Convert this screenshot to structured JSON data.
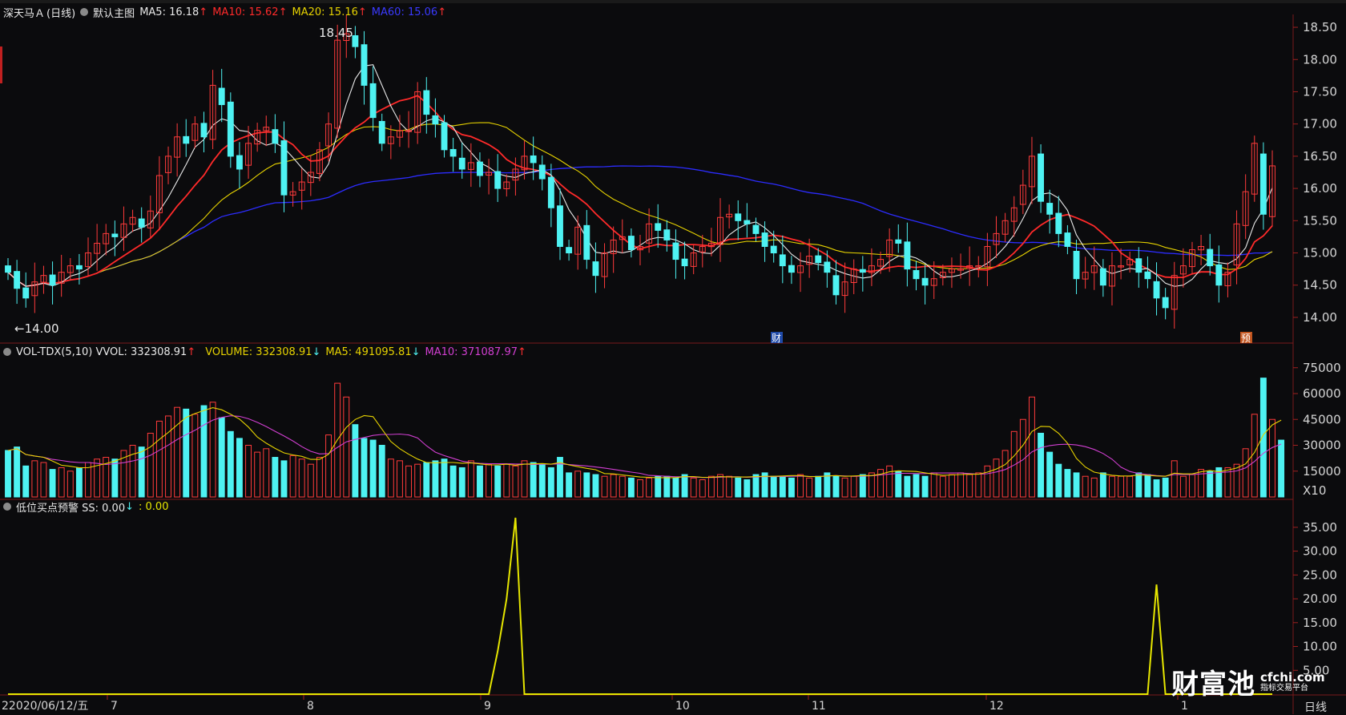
{
  "main_panel": {
    "stock_name": "深天马Ａ",
    "period": "(日线)",
    "template": "默认主图",
    "indicators": [
      {
        "label": "MA5: 16.18",
        "arrow": "↑",
        "color": "#e8e8e8"
      },
      {
        "label": "MA10: 15.62",
        "arrow": "↑",
        "color": "#ff2a2a"
      },
      {
        "label": "MA20: 15.16",
        "arrow": "↑",
        "color": "#e6d200"
      },
      {
        "label": "MA60: 15.06",
        "arrow": "↑",
        "color": "#2c2cff"
      }
    ],
    "high_marker": "18.45",
    "low_marker": "←14.00",
    "event_tags": [
      "财",
      "预"
    ]
  },
  "volume_panel": {
    "indicator": "VOL-TDX(5,10) VVOL: 332308.91",
    "indicator_arrow": "↑",
    "items": [
      {
        "label": "VOLUME: 332308.91",
        "arrow": "↓",
        "color": "#e6d200"
      },
      {
        "label": "MA5: 491095.81",
        "arrow": "↓",
        "color": "#e6d200"
      },
      {
        "label": "MA10: 371087.97",
        "arrow": "↑",
        "color": "#d13fd1"
      }
    ],
    "unit": "X10"
  },
  "signal_panel": {
    "indicator": "低位买点预警 SS: 0.00",
    "arrow": "↓",
    "extra": ": 0.00"
  },
  "date_axis": {
    "first_label": "2020/06/12/五",
    "months": [
      "7",
      "8",
      "9",
      "10",
      "11",
      "12",
      "1"
    ]
  },
  "period_button": "日线",
  "watermark": {
    "brand": "财富池",
    "site": "cfchi.com",
    "tagline": "指标交易平台"
  },
  "colors": {
    "up": "#ff3b3b",
    "down": "#4ef2f2",
    "ma5": "#e8e8e8",
    "ma10": "#ff2a2a",
    "ma20": "#e6d200",
    "ma60": "#2c2cff",
    "ss": "#e6e600"
  },
  "chart_data": [
    {
      "type": "candlestick",
      "title": "深天马Ａ (日线)",
      "y_ticks": [
        14.0,
        14.5,
        15.0,
        15.5,
        16.0,
        16.5,
        17.0,
        17.5,
        18.0,
        18.5
      ],
      "ylim": [
        13.85,
        18.6
      ],
      "x_labels": [
        "2020/06/12/五",
        "7",
        "8",
        "9",
        "10",
        "11",
        "12",
        "1"
      ],
      "series": [
        {
          "name": "MA5",
          "last": 16.18
        },
        {
          "name": "MA10",
          "last": 15.62
        },
        {
          "name": "MA20",
          "last": 15.16
        },
        {
          "name": "MA60",
          "last": 15.06
        }
      ],
      "annotations": [
        "18.45",
        "←14.00"
      ],
      "closes": [
        14.7,
        14.45,
        14.3,
        14.55,
        14.65,
        14.5,
        14.7,
        14.8,
        14.75,
        15.0,
        15.15,
        15.3,
        15.25,
        15.45,
        15.55,
        15.4,
        15.65,
        16.2,
        16.5,
        16.8,
        16.7,
        17.0,
        16.8,
        17.6,
        17.3,
        16.5,
        16.3,
        16.7,
        16.9,
        16.95,
        16.7,
        15.9,
        15.95,
        16.1,
        16.25,
        16.6,
        17.0,
        18.3,
        18.4,
        18.2,
        17.6,
        17.1,
        16.7,
        16.8,
        16.9,
        16.9,
        17.5,
        17.15,
        17.0,
        16.6,
        16.5,
        16.3,
        16.4,
        16.2,
        16.25,
        16.0,
        16.1,
        16.3,
        16.5,
        16.4,
        16.15,
        15.7,
        15.1,
        15.0,
        15.4,
        14.9,
        14.65,
        15.0,
        15.2,
        15.25,
        15.05,
        15.1,
        15.45,
        15.35,
        15.2,
        14.9,
        14.8,
        15.0,
        15.1,
        15.15,
        15.55,
        15.6,
        15.5,
        15.45,
        15.3,
        15.1,
        15.0,
        14.8,
        14.7,
        14.8,
        14.95,
        14.85,
        14.7,
        14.35,
        14.55,
        14.75,
        14.7,
        14.8,
        14.9,
        15.2,
        15.15,
        14.75,
        14.6,
        14.5,
        14.6,
        14.7,
        14.75,
        14.75,
        14.8,
        14.8,
        15.1,
        15.3,
        15.5,
        15.7,
        16.05,
        16.5,
        15.8,
        15.6,
        15.3,
        15.1,
        14.6,
        14.7,
        14.8,
        14.5,
        14.8,
        14.8,
        14.9,
        14.7,
        14.6,
        14.3,
        14.15,
        14.65,
        14.8,
        15.05,
        15.1,
        14.8,
        14.5,
        14.7,
        15.45,
        15.95,
        16.7,
        15.6,
        16.35
      ]
    },
    {
      "type": "bar",
      "title": "VOL-TDX(5,10)",
      "unit": "X10",
      "y_ticks": [
        15000,
        30000,
        45000,
        60000,
        75000
      ],
      "ylim": [
        0,
        80000
      ],
      "series": [
        {
          "name": "VOLUME",
          "last": 332308.91
        },
        {
          "name": "MA5",
          "last": 491095.81
        },
        {
          "name": "MA10",
          "last": 371087.97
        }
      ],
      "values": [
        27000,
        29000,
        18000,
        21000,
        20000,
        16000,
        17000,
        15000,
        17000,
        20000,
        22000,
        23000,
        22000,
        27000,
        30000,
        29000,
        37000,
        44000,
        47000,
        52000,
        51000,
        48000,
        53000,
        55000,
        46000,
        38000,
        34000,
        30000,
        26000,
        28000,
        23000,
        21000,
        24000,
        22000,
        19000,
        23000,
        36000,
        66000,
        58000,
        42000,
        34000,
        33000,
        30000,
        22000,
        21000,
        18000,
        19000,
        20000,
        21000,
        22000,
        18000,
        17000,
        21000,
        18000,
        19000,
        18000,
        19000,
        18000,
        21000,
        20000,
        19000,
        17000,
        23000,
        14000,
        15000,
        14000,
        13000,
        12000,
        13000,
        12000,
        11000,
        10000,
        11000,
        12000,
        12000,
        11000,
        13000,
        11000,
        10000,
        12000,
        13000,
        12000,
        11000,
        10000,
        13000,
        14000,
        12000,
        12000,
        11000,
        13000,
        11000,
        12000,
        14000,
        12000,
        11000,
        12000,
        13000,
        14000,
        16000,
        18000,
        15000,
        12000,
        13000,
        12000,
        14000,
        12000,
        13000,
        14000,
        13000,
        14000,
        18000,
        22000,
        27000,
        38000,
        45000,
        58000,
        37000,
        26000,
        19000,
        16000,
        14000,
        12000,
        11000,
        14000,
        12000,
        12000,
        12000,
        14000,
        13000,
        10000,
        11000,
        21000,
        12000,
        13000,
        16000,
        15000,
        17000,
        17000,
        19000,
        28000,
        48000,
        69000,
        45000,
        33000
      ]
    },
    {
      "type": "line",
      "title": "低位买点预警",
      "series": [
        {
          "name": "SS",
          "last": 0.0
        }
      ],
      "y_ticks": [
        5.0,
        10.0,
        15.0,
        20.0,
        25.0,
        30.0,
        35.0
      ],
      "ylim": [
        0,
        38
      ],
      "peaks": [
        {
          "date_region": "9",
          "value": 37
        },
        {
          "date_region": "1",
          "value": 23
        }
      ]
    }
  ]
}
